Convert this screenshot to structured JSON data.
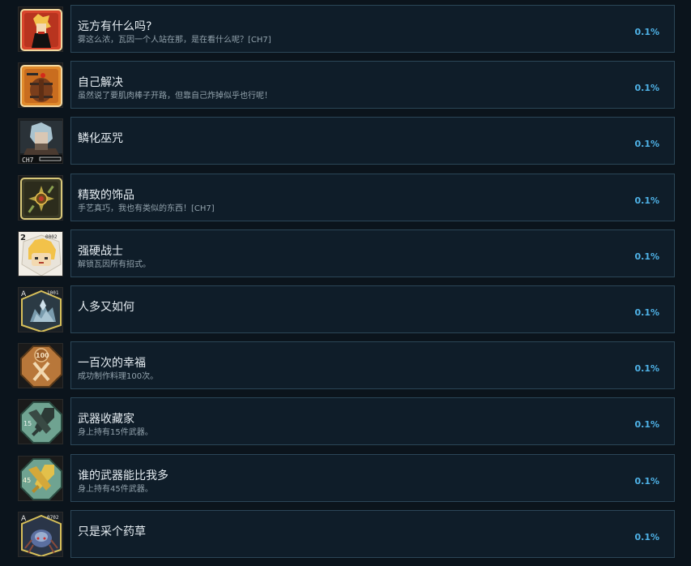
{
  "achievements": [
    {
      "title": "远方有什么吗?",
      "desc": "雾这么浓，瓦因一个人站在那，是在看什么呢？[CH7]",
      "pct": "0.1%",
      "icon": "boy-silhouette-icon",
      "accent": "#d8452c"
    },
    {
      "title": "自己解决",
      "desc": "虽然说了要肌肉棒子开路，但靠自己炸掉似乎也行呢！",
      "pct": "0.1%",
      "icon": "barrel-icon",
      "accent": "#e08a2c"
    },
    {
      "title": "鳞化巫咒",
      "desc": "",
      "pct": "0.1%",
      "icon": "portrait-ch7-icon",
      "icon_text": "CH7",
      "accent": "#7a8fa0"
    },
    {
      "title": "精致的饰品",
      "desc": "手艺真巧，我也有类似的东西！[CH7]",
      "pct": "0.1%",
      "icon": "ornament-icon",
      "accent": "#b5a243"
    },
    {
      "title": "强硬战士",
      "desc": "解锁瓦因所有招式。",
      "pct": "0.1%",
      "icon": "character-face-icon",
      "icon_text": "2",
      "icon_text2": "0002",
      "accent": "#e7c25a"
    },
    {
      "title": "人多又如何",
      "desc": "",
      "pct": "0.1%",
      "icon": "crystal-pile-icon",
      "icon_text": "A",
      "icon_text2": "1001",
      "accent": "#5a8aa0"
    },
    {
      "title": "一百次的幸福",
      "desc": "成功制作料理100次。",
      "pct": "0.1%",
      "icon": "cooking-badge-icon",
      "icon_text": "100",
      "accent": "#b8773a"
    },
    {
      "title": "武器收藏家",
      "desc": "身上持有15件武器。",
      "pct": "0.1%",
      "icon": "weapons-15-icon",
      "icon_text": "15",
      "accent": "#6fa391"
    },
    {
      "title": "谁的武器能比我多",
      "desc": "身上持有45件武器。",
      "pct": "0.1%",
      "icon": "weapons-45-icon",
      "icon_text": "45",
      "accent": "#d4b246"
    },
    {
      "title": "只是采个药草",
      "desc": "",
      "pct": "0.1%",
      "icon": "spider-icon",
      "icon_text": "A",
      "icon_text2": "0702",
      "accent": "#5b6fa0"
    }
  ]
}
